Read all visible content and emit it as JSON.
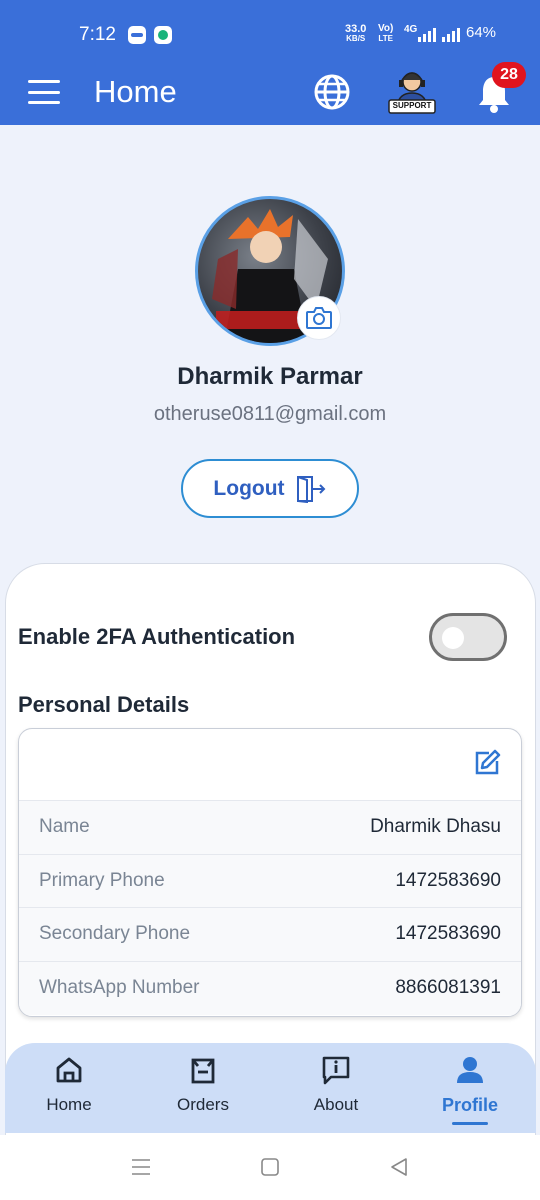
{
  "status_bar": {
    "time": "7:12",
    "speed_value": "33.0",
    "speed_unit": "KB/S",
    "volte_top": "Vo)",
    "volte_bottom": "LTE",
    "network": "4G",
    "battery": "64%"
  },
  "header": {
    "title": "Home",
    "support_label": "SUPPORT",
    "notification_count": "28"
  },
  "profile": {
    "name": "Dharmik Parmar",
    "email": "otheruse0811@gmail.com",
    "logout_label": "Logout"
  },
  "settings": {
    "twofa_label": "Enable 2FA Authentication",
    "twofa_enabled": false
  },
  "personal_details": {
    "title": "Personal Details",
    "rows": [
      {
        "label": "Name",
        "value": "Dharmik Dhasu"
      },
      {
        "label": "Primary Phone",
        "value": "1472583690"
      },
      {
        "label": "Secondary Phone",
        "value": "1472583690"
      },
      {
        "label": "WhatsApp Number",
        "value": "8866081391"
      }
    ]
  },
  "bottom_nav": {
    "items": [
      {
        "label": "Home",
        "icon": "home-icon"
      },
      {
        "label": "Orders",
        "icon": "orders-icon"
      },
      {
        "label": "About",
        "icon": "about-icon"
      },
      {
        "label": "Profile",
        "icon": "profile-icon"
      }
    ],
    "active": "Profile"
  },
  "colors": {
    "header_bg": "#3a6fd9",
    "accent": "#2f76d2",
    "badge": "#e0141e",
    "page_bg": "#eef2fb",
    "nav_bg": "#cdddf7"
  }
}
